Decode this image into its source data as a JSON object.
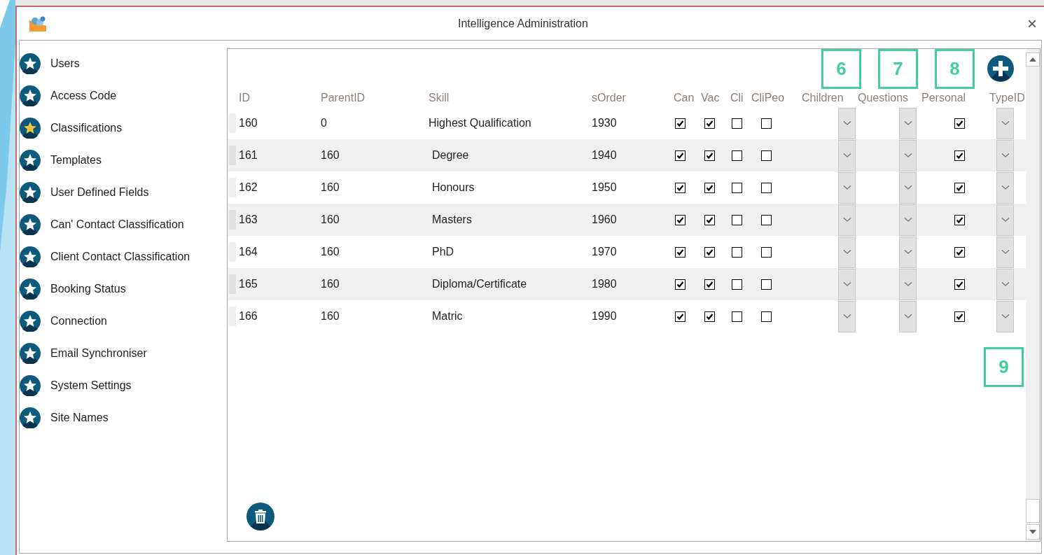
{
  "window": {
    "title": "Intelligence Administration",
    "close": "×"
  },
  "sidebar": {
    "items": [
      {
        "label": "Users",
        "selected": false
      },
      {
        "label": "Access Code",
        "selected": false
      },
      {
        "label": "Classifications",
        "selected": true
      },
      {
        "label": "Templates",
        "selected": false
      },
      {
        "label": "User Defined Fields",
        "selected": false
      },
      {
        "label": "Can' Contact Classification",
        "selected": false
      },
      {
        "label": "Client Contact Classification",
        "selected": false
      },
      {
        "label": "Booking Status",
        "selected": false
      },
      {
        "label": "Connection",
        "selected": false
      },
      {
        "label": "Email Synchroniser",
        "selected": false
      },
      {
        "label": "System Settings",
        "selected": false
      },
      {
        "label": "Site Names",
        "selected": false
      }
    ]
  },
  "table": {
    "columns": [
      "ID",
      "ParentID",
      "Skill",
      "sOrder",
      "Can",
      "Vac",
      "Cli",
      "CliPeo",
      "Children",
      "Questions",
      "Personal",
      "TypeID"
    ],
    "rows": [
      {
        "id": "160",
        "parent_id": "0",
        "skill": "Highest Qualification",
        "s_order": "1930",
        "can": true,
        "vac": true,
        "cli": false,
        "clipeo": false,
        "personal": true
      },
      {
        "id": "161",
        "parent_id": "160",
        "skill": "Degree",
        "s_order": "1940",
        "can": true,
        "vac": true,
        "cli": false,
        "clipeo": false,
        "personal": true
      },
      {
        "id": "162",
        "parent_id": "160",
        "skill": "Honours",
        "s_order": "1950",
        "can": true,
        "vac": true,
        "cli": false,
        "clipeo": false,
        "personal": true
      },
      {
        "id": "163",
        "parent_id": "160",
        "skill": "Masters",
        "s_order": "1960",
        "can": true,
        "vac": true,
        "cli": false,
        "clipeo": false,
        "personal": true
      },
      {
        "id": "164",
        "parent_id": "160",
        "skill": "PhD",
        "s_order": "1970",
        "can": true,
        "vac": true,
        "cli": false,
        "clipeo": false,
        "personal": true
      },
      {
        "id": "165",
        "parent_id": "160",
        "skill": "Diploma/Certificate",
        "s_order": "1980",
        "can": true,
        "vac": true,
        "cli": false,
        "clipeo": false,
        "personal": true
      },
      {
        "id": "166",
        "parent_id": "160",
        "skill": "Matric",
        "s_order": "1990",
        "can": true,
        "vac": true,
        "cli": false,
        "clipeo": false,
        "personal": true
      }
    ]
  },
  "callouts": [
    "6",
    "7",
    "8",
    "9"
  ]
}
